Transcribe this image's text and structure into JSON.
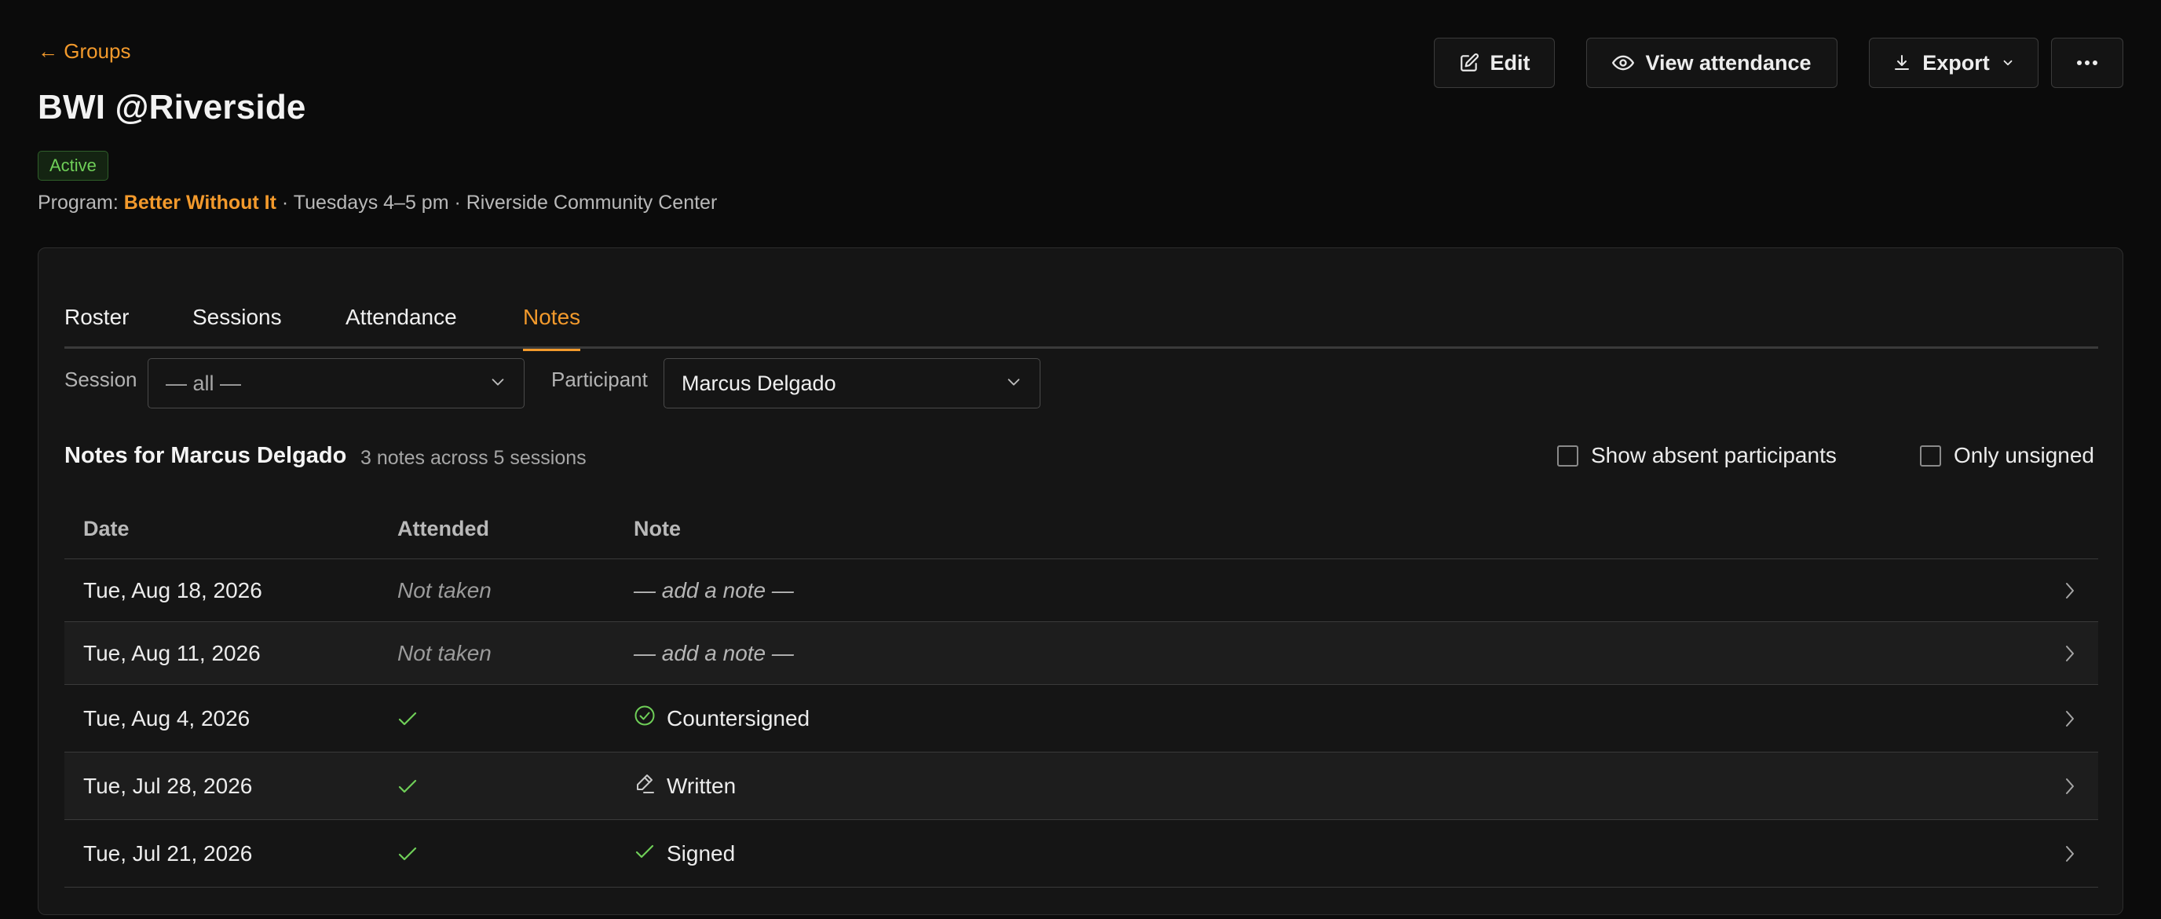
{
  "nav": {
    "back_label": "← Groups"
  },
  "group": {
    "title": "BWI @Riverside",
    "status": "Active",
    "program_prefix": "Program:",
    "program_name": "Better Without It",
    "schedule": " · Tuesdays 4–5 pm · Riverside Community Center"
  },
  "actions": {
    "edit": "Edit",
    "view_attendance": "View attendance",
    "export": "Export",
    "more_icon": "more-horizontal-icon"
  },
  "tabs": [
    {
      "label": "Roster",
      "active": false
    },
    {
      "label": "Sessions",
      "active": false
    },
    {
      "label": "Attendance",
      "active": false
    },
    {
      "label": "Notes",
      "active": true
    }
  ],
  "filters": {
    "session_label": "Session",
    "session_value": "— all —",
    "participant_label": "Participant",
    "participant_value": "Marcus Delgado"
  },
  "notes": {
    "heading": "Notes for Marcus Delgado",
    "summary": "3 notes across 5 sessions",
    "show_absent_label": "Show absent participants",
    "only_unsigned_label": "Only unsigned",
    "show_absent_checked": false,
    "only_unsigned_checked": false
  },
  "table": {
    "headers": {
      "date": "Date",
      "attended": "Attended",
      "note": "Note"
    },
    "rows": [
      {
        "date": "Tue, Aug 18, 2026",
        "attended": "Not taken",
        "note": "— add a note —",
        "note_icon": ""
      },
      {
        "date": "Tue, Aug 11, 2026",
        "attended": "Not taken",
        "note": "— add a note —",
        "note_icon": ""
      },
      {
        "date": "Tue, Aug 4, 2026",
        "attended": "check",
        "note": "Countersigned",
        "note_icon": "check-circle-icon"
      },
      {
        "date": "Tue, Jul 28, 2026",
        "attended": "check",
        "note": "Written",
        "note_icon": "pen-icon"
      },
      {
        "date": "Tue, Jul 21, 2026",
        "attended": "check",
        "note": "Signed",
        "note_icon": "check-icon"
      }
    ]
  },
  "colors": {
    "accent": "#f39a2c",
    "success": "#6fcf58",
    "background": "#0b0b0b",
    "card": "#151515"
  }
}
